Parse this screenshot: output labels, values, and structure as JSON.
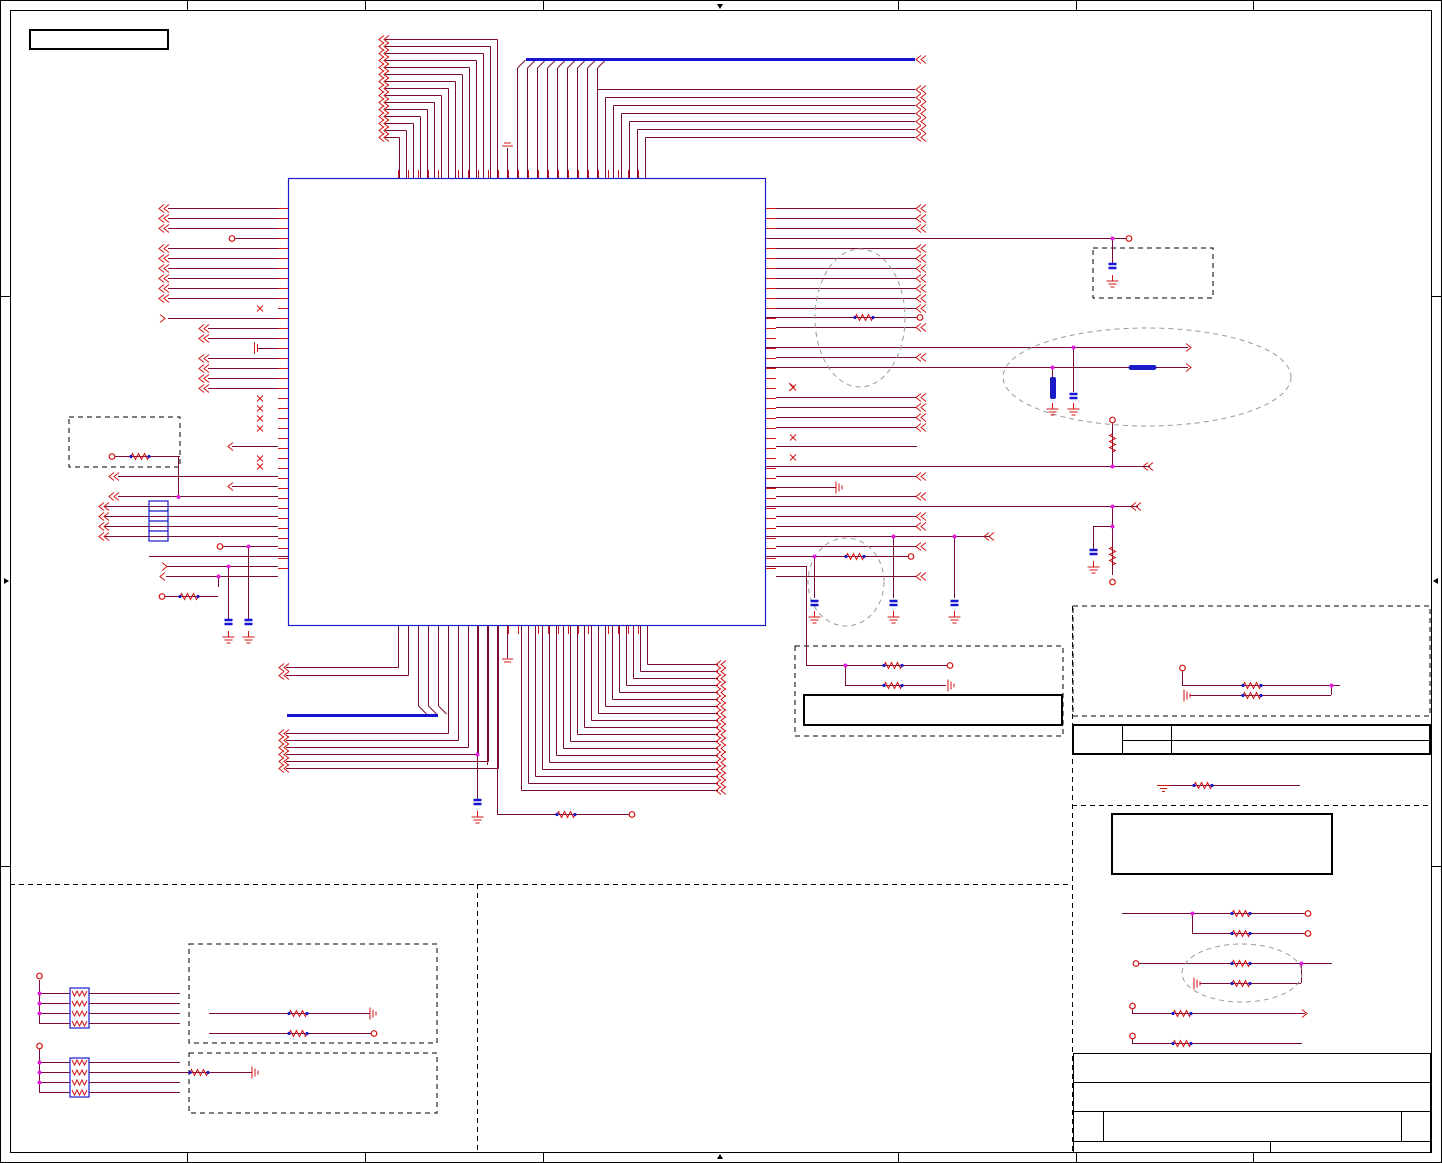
{
  "schematic": {
    "sheet_width": 1442,
    "sheet_height": 1163,
    "colors": {
      "wire": "#7a0a3a",
      "pin": "#d21414",
      "component": "#1a1ac8",
      "junction": "#e01ee0",
      "border": "#000000",
      "annotation_outline": "#9a9a9a"
    },
    "symbols": [
      "ic-body-icon",
      "resistor-icon",
      "capacitor-icon",
      "ground-icon",
      "off-page-connector-icon",
      "power-port-icon",
      "no-connect-icon",
      "resistor-array-icon",
      "ferrite-bead-icon"
    ]
  }
}
